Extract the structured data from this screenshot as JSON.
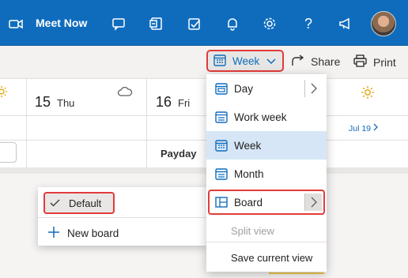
{
  "topbar": {
    "meet_now_label": "Meet Now",
    "icons": [
      "video-icon",
      "chat-icon",
      "office-icon",
      "todo-icon",
      "bell-icon",
      "gear-icon",
      "help-icon",
      "megaphone-icon"
    ],
    "help_glyph": "?"
  },
  "toolbar": {
    "view_label": "Week",
    "share_label": "Share",
    "print_label": "Print"
  },
  "calendar": {
    "days": [
      {
        "num": "15",
        "name": "Thu"
      },
      {
        "num": "16",
        "name": "Fri"
      }
    ],
    "event": "Payday",
    "next_week_label": "Jul 19"
  },
  "board_menu": {
    "default_label": "Default",
    "new_board_label": "New board"
  },
  "view_menu": {
    "items": [
      {
        "label": "Day"
      },
      {
        "label": "Work week"
      },
      {
        "label": "Week"
      },
      {
        "label": "Month"
      },
      {
        "label": "Board"
      },
      {
        "label": "Split view"
      },
      {
        "label": "Save current view"
      }
    ],
    "selected": "Week"
  },
  "colors": {
    "accent": "#0f6cbd",
    "highlight_border": "#e23b3b",
    "selected_bg": "#d6e6f6"
  }
}
